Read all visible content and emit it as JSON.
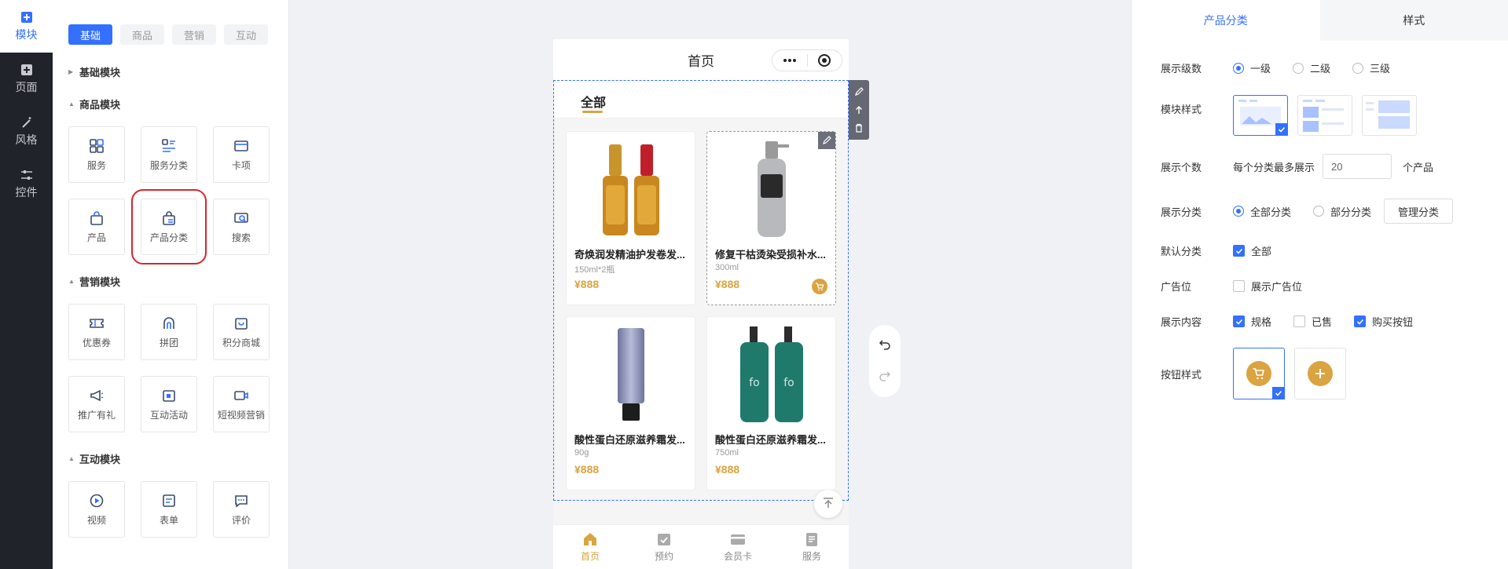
{
  "rail": {
    "items": [
      {
        "label": "模块",
        "icon": "add-square-icon",
        "active": true
      },
      {
        "label": "页面",
        "icon": "page-add-icon"
      },
      {
        "label": "风格",
        "icon": "magic-wand-icon"
      },
      {
        "label": "控件",
        "icon": "sliders-icon"
      }
    ]
  },
  "panel": {
    "tabs": [
      "基础",
      "商品",
      "营销",
      "互动"
    ],
    "sections": {
      "basic": "基础模块",
      "goods": "商品模块",
      "marketing": "营销模块",
      "interact": "互动模块"
    },
    "goods_tiles": [
      "服务",
      "服务分类",
      "卡项",
      "产品",
      "产品分类",
      "搜索"
    ],
    "marketing_tiles": [
      "优惠券",
      "拼团",
      "积分商城",
      "推广有礼",
      "互动活动",
      "短视频营销"
    ],
    "interact_tiles": [
      "视频",
      "表单",
      "评价"
    ]
  },
  "phone": {
    "title": "首页",
    "category_active": "全部",
    "products": [
      {
        "name": "奇焕润发精油护发卷发...",
        "spec": "150ml*2瓶",
        "price": "¥888"
      },
      {
        "name": "修复干枯烫染受损补水...",
        "spec": "300ml",
        "price": "¥888"
      },
      {
        "name": "酸性蛋白还原滋养霜发...",
        "spec": "90g",
        "price": "¥888"
      },
      {
        "name": "酸性蛋白还原滋养霜发...",
        "spec": "750ml",
        "price": "¥888"
      }
    ],
    "tabbar": [
      "首页",
      "预约",
      "会员卡",
      "服务"
    ]
  },
  "settings": {
    "tabs": [
      "产品分类",
      "样式"
    ],
    "level_label": "展示级数",
    "levels": [
      "一级",
      "二级",
      "三级"
    ],
    "style_label": "模块样式",
    "count_label": "展示个数",
    "count_prefix": "每个分类最多展示",
    "count_value": "20",
    "count_suffix": "个产品",
    "category_label": "展示分类",
    "category_options": [
      "全部分类",
      "部分分类"
    ],
    "manage_button": "管理分类",
    "default_label": "默认分类",
    "default_option": "全部",
    "ad_label": "广告位",
    "ad_option": "展示广告位",
    "content_label": "展示内容",
    "content_options": [
      "规格",
      "已售",
      "购买按钮"
    ],
    "button_style_label": "按钮样式"
  },
  "colors": {
    "accent": "#3370ff",
    "gold": "#d9a441",
    "rail": "#20232a",
    "highlight": "#d9262c"
  }
}
